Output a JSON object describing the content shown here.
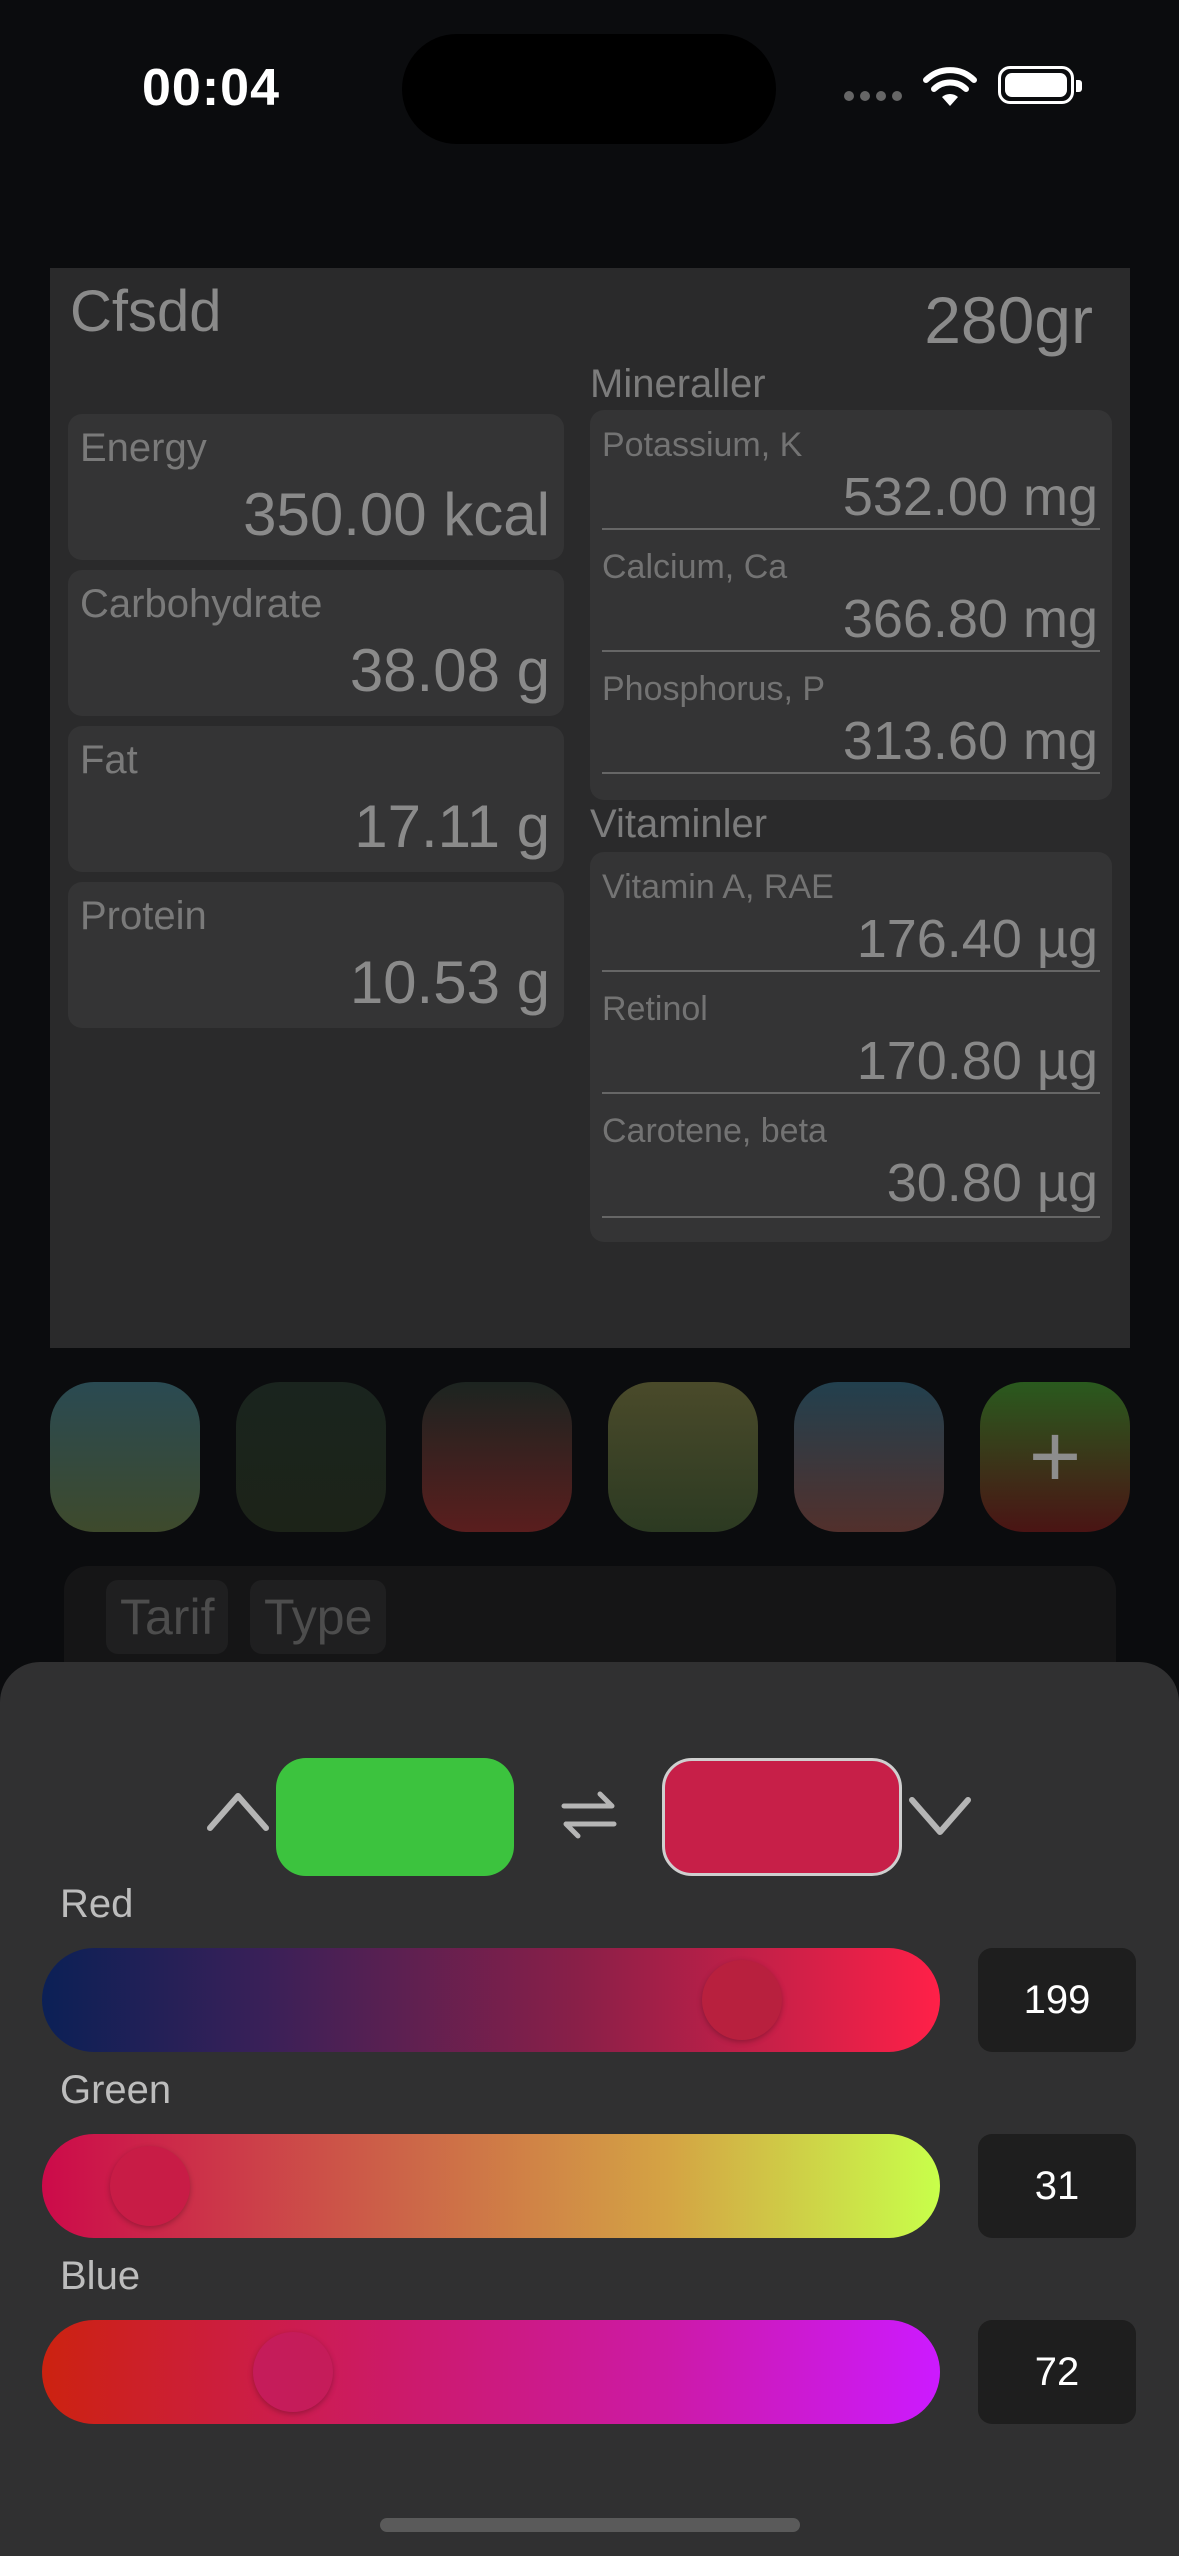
{
  "status_bar": {
    "time": "00:04"
  },
  "card": {
    "title": "Cfsdd",
    "weight": "280gr",
    "macros": [
      {
        "label": "Energy",
        "value": "350.00 kcal"
      },
      {
        "label": "Carbohydrate",
        "value": "38.08 g"
      },
      {
        "label": "Fat",
        "value": "17.11 g"
      },
      {
        "label": "Protein",
        "value": "10.53 g"
      }
    ],
    "minerals": {
      "heading": "Mineraller",
      "items": [
        {
          "label": "Potassium, K",
          "value": "532.00 mg"
        },
        {
          "label": "Calcium, Ca",
          "value": "366.80 mg"
        },
        {
          "label": "Phosphorus, P",
          "value": "313.60 mg"
        }
      ]
    },
    "vitamins": {
      "heading": "Vitaminler",
      "items": [
        {
          "label": "Vitamin A, RAE",
          "value": "176.40 µg"
        },
        {
          "label": "Retinol",
          "value": "170.80 µg"
        },
        {
          "label": "Carotene, beta",
          "value": "30.80 µg"
        }
      ]
    }
  },
  "swatches": {
    "add_label": "+"
  },
  "tabs": [
    {
      "label": "Tarif"
    },
    {
      "label": "Type"
    }
  ],
  "color_picker": {
    "primary_color": "#3cc33e",
    "secondary_color": "#c71f48",
    "sliders": [
      {
        "label": "Red",
        "value": "199",
        "fraction": 0.78
      },
      {
        "label": "Green",
        "value": "31",
        "fraction": 0.12
      },
      {
        "label": "Blue",
        "value": "72",
        "fraction": 0.28
      }
    ]
  }
}
